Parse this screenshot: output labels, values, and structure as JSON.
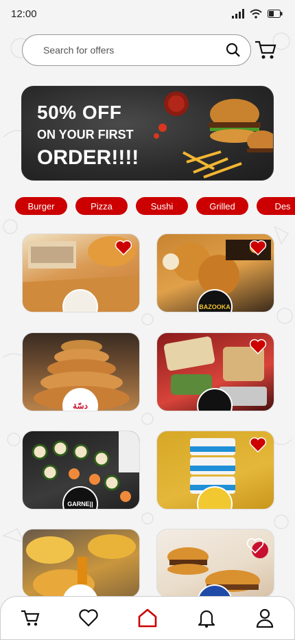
{
  "status_bar": {
    "time": "12:00"
  },
  "search": {
    "placeholder": "Search for offers"
  },
  "banner": {
    "line1": "50% OFF",
    "line2": "ON YOUR FIRST",
    "line3": "ORDER!!!!"
  },
  "categories": [
    "Burger",
    "Pizza",
    "Sushi",
    "Grilled",
    "Des"
  ],
  "restaurants": [
    {
      "logo_text": "",
      "favorited": true
    },
    {
      "logo_text": "BAZOOKA",
      "favorited": true
    },
    {
      "logo_text": "دسّة",
      "favorited": false
    },
    {
      "logo_text": "",
      "favorited": true
    },
    {
      "logo_text": "GARNE||",
      "favorited": false
    },
    {
      "logo_text": "",
      "favorited": true
    },
    {
      "logo_text": "",
      "favorited": false
    },
    {
      "logo_text": "",
      "favorited": false
    }
  ],
  "colors": {
    "accent": "#cc0000"
  },
  "bottom_nav": [
    "cart-icon",
    "heart-icon",
    "home-icon",
    "bell-icon",
    "user-icon"
  ]
}
